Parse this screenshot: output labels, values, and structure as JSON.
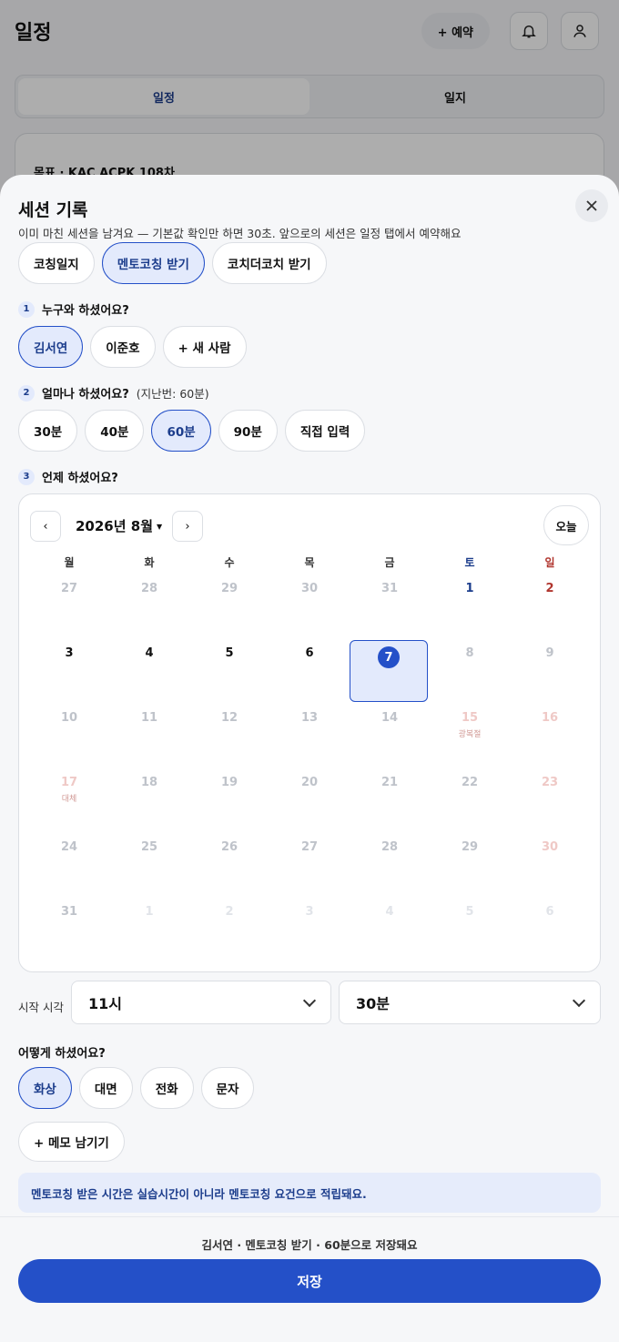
{
  "background": {
    "title": "일정",
    "reserve_label": "+ 예약",
    "tabs": [
      {
        "label": "일정"
      },
      {
        "label": "일지"
      }
    ],
    "card_text": "목표 · KAC ACPK 108차"
  },
  "sheet": {
    "title": "세션 기록",
    "subtitle": "이미 마친 세션을 남겨요 — 기본값 확인만 하면 30초. 앞으로의 세션은 일정 탭에서 예약해요",
    "types": [
      {
        "label": "코칭일지"
      },
      {
        "label": "멘토코칭 받기"
      },
      {
        "label": "코치더코치 받기"
      }
    ],
    "q1": {
      "num": "1",
      "label": "누구와 하셨어요?"
    },
    "people": [
      {
        "label": "김서연"
      },
      {
        "label": "이준호"
      },
      {
        "label": "+ 새 사람"
      }
    ],
    "q2": {
      "num": "2",
      "label": "얼마나 하셨어요?",
      "hint": "(지난번: 60분)"
    },
    "durations": [
      {
        "label": "30분"
      },
      {
        "label": "40분"
      },
      {
        "label": "60분"
      },
      {
        "label": "90분"
      },
      {
        "label": "직접 입력"
      }
    ],
    "q3": {
      "num": "3",
      "label": "언제 하셨어요?"
    },
    "calendar": {
      "prev": "‹",
      "next": "›",
      "month": "2026년 8월",
      "today_label": "오늘",
      "weekdays": [
        "월",
        "화",
        "수",
        "목",
        "금",
        "토",
        "일"
      ],
      "weeks": [
        [
          {
            "d": "27",
            "t": "dim"
          },
          {
            "d": "28",
            "t": "dim"
          },
          {
            "d": "29",
            "t": "dim"
          },
          {
            "d": "30",
            "t": "dim"
          },
          {
            "d": "31",
            "t": "dim"
          },
          {
            "d": "1",
            "t": "sat"
          },
          {
            "d": "2",
            "t": "sun"
          }
        ],
        [
          {
            "d": "3",
            "t": "cur"
          },
          {
            "d": "4",
            "t": "cur"
          },
          {
            "d": "5",
            "t": "cur"
          },
          {
            "d": "6",
            "t": "cur"
          },
          {
            "d": "7",
            "t": "sel"
          },
          {
            "d": "8",
            "t": "dim"
          },
          {
            "d": "9",
            "t": "dim"
          }
        ],
        [
          {
            "d": "10",
            "t": "dim"
          },
          {
            "d": "11",
            "t": "dim"
          },
          {
            "d": "12",
            "t": "dim"
          },
          {
            "d": "13",
            "t": "dim"
          },
          {
            "d": "14",
            "t": "dim"
          },
          {
            "d": "15",
            "t": "sundim",
            "h": "광복절"
          },
          {
            "d": "16",
            "t": "sundim"
          }
        ],
        [
          {
            "d": "17",
            "t": "sundim",
            "h": "대체"
          },
          {
            "d": "18",
            "t": "dim"
          },
          {
            "d": "19",
            "t": "dim"
          },
          {
            "d": "20",
            "t": "dim"
          },
          {
            "d": "21",
            "t": "dim"
          },
          {
            "d": "22",
            "t": "dim"
          },
          {
            "d": "23",
            "t": "sundim"
          }
        ],
        [
          {
            "d": "24",
            "t": "dim"
          },
          {
            "d": "25",
            "t": "dim"
          },
          {
            "d": "26",
            "t": "dim"
          },
          {
            "d": "27",
            "t": "dim"
          },
          {
            "d": "28",
            "t": "dim"
          },
          {
            "d": "29",
            "t": "dim"
          },
          {
            "d": "30",
            "t": "sundim"
          }
        ],
        [
          {
            "d": "31",
            "t": "dim"
          },
          {
            "d": "1",
            "t": "faint"
          },
          {
            "d": "2",
            "t": "faint"
          },
          {
            "d": "3",
            "t": "faint"
          },
          {
            "d": "4",
            "t": "faint"
          },
          {
            "d": "5",
            "t": "faint"
          },
          {
            "d": "6",
            "t": "faint"
          }
        ]
      ]
    },
    "start_time": {
      "label": "시작 시각",
      "hour": "11시",
      "minute": "30분"
    },
    "how": {
      "label": "어떻게 하셨어요?",
      "options": [
        {
          "label": "화상"
        },
        {
          "label": "대면"
        },
        {
          "label": "전화"
        },
        {
          "label": "문자"
        }
      ]
    },
    "memo_label": "+ 메모 남기기",
    "info_text": "멘토코칭 받은 시간은 실습시간이 아니라 멘토코칭 요건으로 적립돼요.",
    "summary": "김서연 · 멘토코칭 받기 · 60분으로 저장돼요",
    "save_label": "저장"
  },
  "colors": {
    "accent": "#2450c8",
    "accent_light": "#e3eafc",
    "saturday": "#1c3d8c",
    "sunday": "#b0352e"
  }
}
